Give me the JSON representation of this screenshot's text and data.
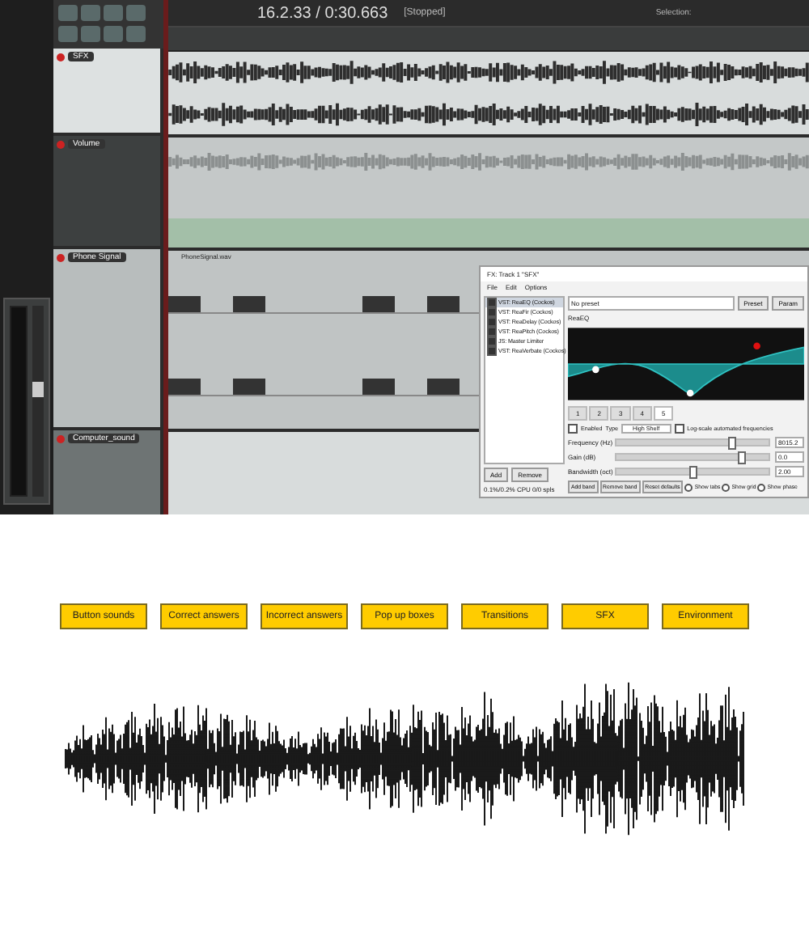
{
  "daw": {
    "time": "16.2.33 / 0:30.663",
    "play_state": "[Stopped]",
    "selection_label": "Selection:",
    "tracks": [
      {
        "name": "SFX",
        "kind": "audio",
        "selected": true
      },
      {
        "name": "Volume",
        "kind": "envelope",
        "selected": false
      },
      {
        "name": "Phone Signal",
        "kind": "blocks",
        "selected": false
      },
      {
        "name": "Computer_sound",
        "kind": "audio",
        "selected": false
      }
    ],
    "item_label": "PhoneSignal.wav",
    "fx_window": {
      "title": "FX: Track 1 \"SFX\"",
      "menu": [
        "File",
        "Edit",
        "Options"
      ],
      "plugins": [
        {
          "name": "VST: ReaEQ (Cockos)",
          "enabled": true,
          "selected": true
        },
        {
          "name": "VST: ReaFir (Cockos)",
          "enabled": true,
          "selected": false
        },
        {
          "name": "VST: ReaDelay (Cockos)",
          "enabled": true,
          "selected": false
        },
        {
          "name": "VST: ReaPitch (Cockos)",
          "enabled": true,
          "selected": false
        },
        {
          "name": "JS: Master Limiter",
          "enabled": true,
          "selected": false
        },
        {
          "name": "VST: ReaVerbate (Cockos)",
          "enabled": true,
          "selected": false
        }
      ],
      "list_buttons": [
        "Add",
        "Remove"
      ],
      "cpu": "0.1%/0.2% CPU 0/0 spls",
      "preset": "No preset",
      "preset_buttons": [
        "Preset",
        "Param"
      ],
      "plugin_label": "ReaEQ",
      "bands": [
        {
          "label": "1",
          "selected": false
        },
        {
          "label": "2",
          "selected": false
        },
        {
          "label": "3",
          "selected": false
        },
        {
          "label": "4",
          "selected": false
        },
        {
          "label": "5",
          "selected": true
        }
      ],
      "enabled_label": "Enabled",
      "enabled": false,
      "type_label": "Type",
      "type": "High Shelf",
      "log_label": "Log-scale automated frequencies",
      "log": false,
      "params": [
        {
          "label": "Frequency (Hz)",
          "level": 0.75,
          "value": "8015.2"
        },
        {
          "label": "Gain (dB)",
          "level": 0.82,
          "value": "0.0"
        },
        {
          "label": "Bandwidth (oct)",
          "level": 0.5,
          "value": "2.00"
        }
      ],
      "bottom_buttons": [
        "Add band",
        "Remove band",
        "Reset defaults"
      ],
      "options": [
        {
          "label": "Show tabs",
          "checked": false
        },
        {
          "label": "Show grid",
          "checked": false
        },
        {
          "label": "Show phase",
          "checked": false
        }
      ]
    }
  },
  "categories": [
    "Button sounds",
    "Correct answers",
    "Incorrect answers",
    "Pop up boxes",
    "Transitions",
    "SFX",
    "Environment"
  ]
}
